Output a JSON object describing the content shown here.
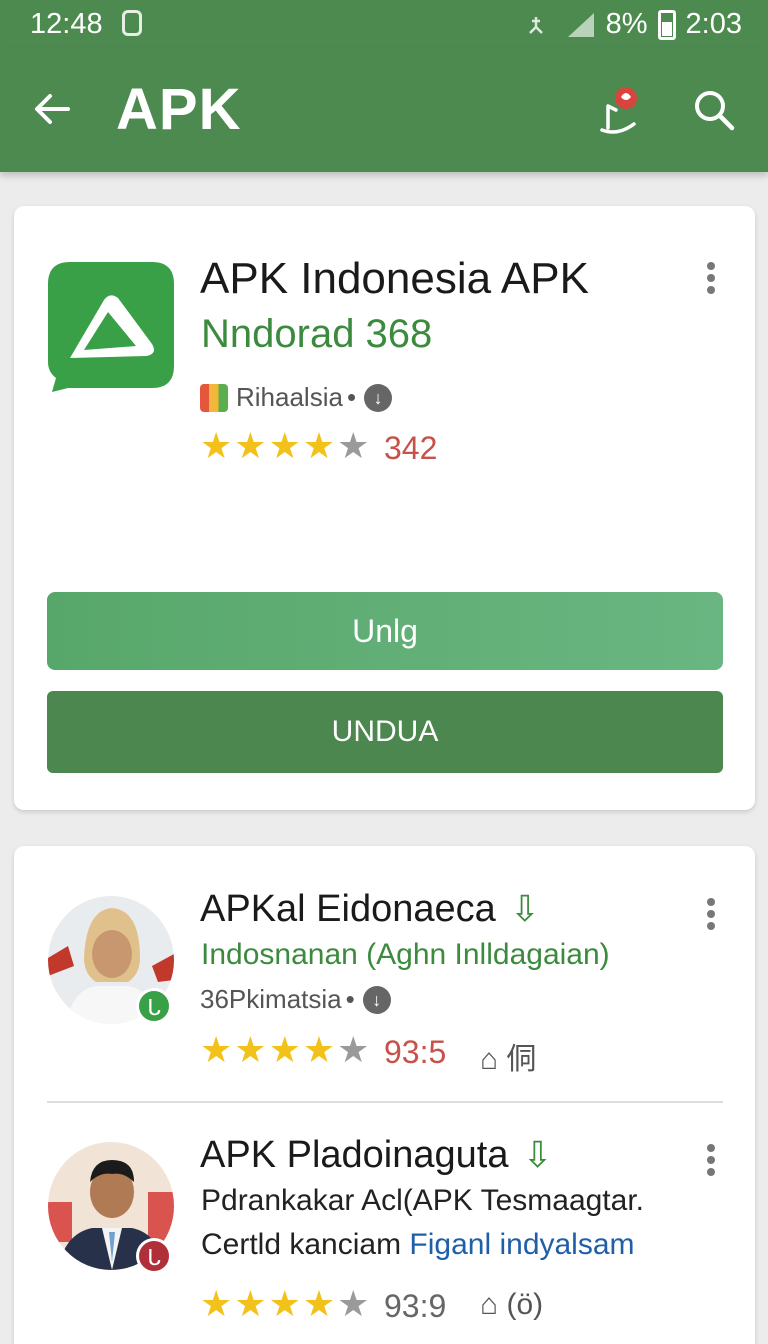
{
  "status_bar": {
    "time_left": "12:48",
    "battery": "8%",
    "time_right": "2:03"
  },
  "app_bar": {
    "title": "APK",
    "icons": [
      "back-arrow-icon",
      "favorite-badge-icon",
      "search-icon"
    ]
  },
  "featured": {
    "name": "APK Indonesia APK",
    "subtitle": "Nndorad 368",
    "developer": "Rihaalsia",
    "rating_text": "342",
    "stars": 4,
    "primary_button": "Unlg",
    "secondary_button": "UNDUA"
  },
  "list": [
    {
      "name": "APKal Eidonaeca",
      "subtitle": "Indosnanan (Aghn Inlldagaian)",
      "developer": "36Pkimatsia",
      "stars": 4,
      "rating_text": "93:5",
      "extra": "⌂ 侗"
    },
    {
      "name": "APK Pladoinaguta",
      "desc_line1": "Pdrankakar Acl(APK Tesmaagtar.",
      "desc_line2_plain": "Certld kanciam",
      "desc_line2_link": "Figanl indyalsam",
      "stars": 4,
      "rating_text": "93:9",
      "extra": "⌂ (ö)"
    }
  ],
  "colors": {
    "app_bar": "#4d8a50",
    "accent_green": "#3b8a3e",
    "rating_red": "#c8524b",
    "star_gold": "#f2c21a",
    "link_blue": "#1f5fa8"
  }
}
